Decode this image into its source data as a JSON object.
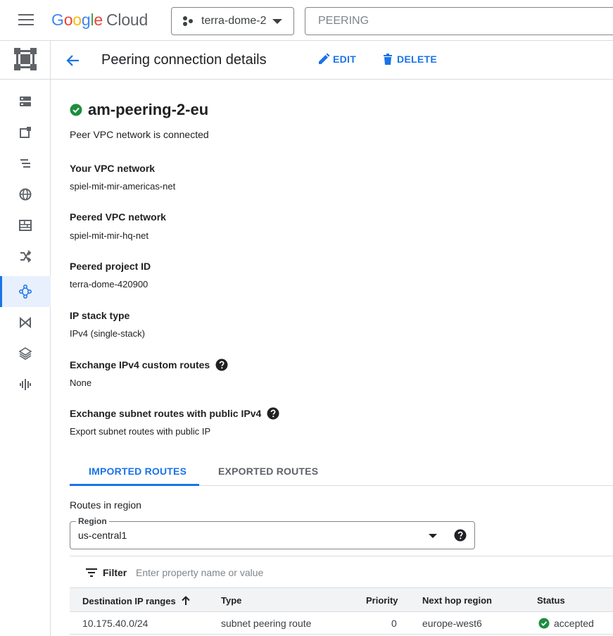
{
  "topbar": {
    "logo_google_g": "G",
    "logo_google_o1": "o",
    "logo_google_o2": "o",
    "logo_google_g2": "g",
    "logo_google_l": "l",
    "logo_google_e": "e",
    "logo_cloud": "Cloud",
    "project_name": "terra-dome-2",
    "search_value": "PEERING"
  },
  "header": {
    "title": "Peering connection details",
    "edit_label": "EDIT",
    "delete_label": "DELETE"
  },
  "details": {
    "name": "am-peering-2-eu",
    "status_text": "Peer VPC network is connected",
    "fields": [
      {
        "label": "Your VPC network",
        "value": "spiel-mit-mir-americas-net"
      },
      {
        "label": "Peered VPC network",
        "value": "spiel-mit-mir-hq-net"
      },
      {
        "label": "Peered project ID",
        "value": "terra-dome-420900"
      },
      {
        "label": "IP stack type",
        "value": "IPv4 (single-stack)"
      },
      {
        "label": "Exchange IPv4 custom routes",
        "value": "None"
      },
      {
        "label": "Exchange subnet routes with public IPv4",
        "value": "Export subnet routes with public IP"
      }
    ]
  },
  "tabs": [
    {
      "label": "IMPORTED ROUTES",
      "active": true
    },
    {
      "label": "EXPORTED ROUTES",
      "active": false
    }
  ],
  "routes": {
    "title": "Routes in region",
    "region_label": "Region",
    "region_value": "us-central1",
    "filter_label": "Filter",
    "filter_placeholder": "Enter property name or value",
    "columns": [
      "Destination IP ranges",
      "Type",
      "Priority",
      "Next hop region",
      "Status"
    ],
    "rows": [
      {
        "destination": "10.175.40.0/24",
        "type": "subnet peering route",
        "priority": "0",
        "next_hop_region": "europe-west6",
        "status": "accepted"
      }
    ]
  },
  "colors": {
    "accent": "#1a73e8",
    "success": "#1e8e3e",
    "text": "#202124"
  },
  "icons": {
    "menu": "hamburger-menu-icon",
    "project": "project-dots-icon",
    "back": "arrow-left-icon",
    "edit": "pencil-icon",
    "delete": "trash-icon",
    "status_ok": "check-circle-icon",
    "help": "help-circle-icon",
    "filter": "filter-lines-icon",
    "sort": "arrow-up-icon"
  }
}
